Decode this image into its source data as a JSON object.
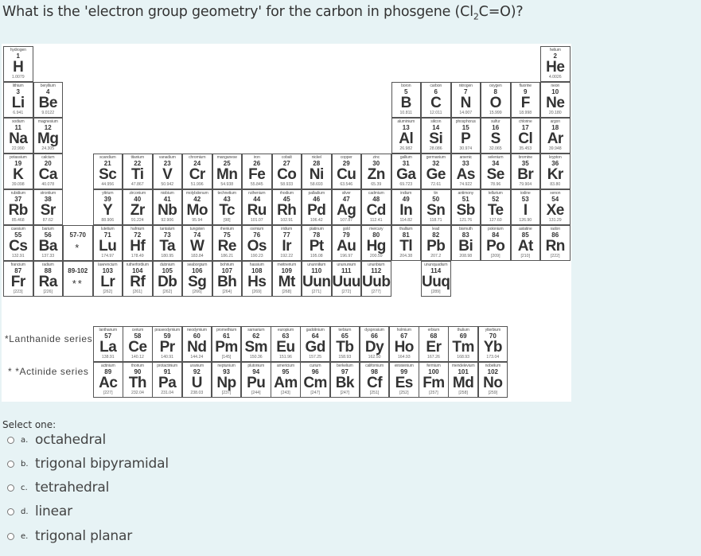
{
  "question": {
    "prefix": "What is the 'electron group geometry' for the carbon in phosgene (Cl",
    "subscript": "2",
    "suffix": "C=O)?"
  },
  "periodic_table": {
    "elements": [
      {
        "name": "hydrogen",
        "z": "1",
        "sym": "H",
        "mass": "1.0079",
        "row": 1,
        "col": 1
      },
      {
        "name": "helium",
        "z": "2",
        "sym": "He",
        "mass": "4.0026",
        "row": 1,
        "col": 19
      },
      {
        "name": "lithium",
        "z": "3",
        "sym": "Li",
        "mass": "6.941",
        "row": 2,
        "col": 1
      },
      {
        "name": "beryllium",
        "z": "4",
        "sym": "Be",
        "mass": "9.0122",
        "row": 2,
        "col": 2
      },
      {
        "name": "boron",
        "z": "5",
        "sym": "B",
        "mass": "10.811",
        "row": 2,
        "col": 14
      },
      {
        "name": "carbon",
        "z": "6",
        "sym": "C",
        "mass": "12.011",
        "row": 2,
        "col": 15
      },
      {
        "name": "nitrogen",
        "z": "7",
        "sym": "N",
        "mass": "14.007",
        "row": 2,
        "col": 16
      },
      {
        "name": "oxygen",
        "z": "8",
        "sym": "O",
        "mass": "15.999",
        "row": 2,
        "col": 17
      },
      {
        "name": "fluorine",
        "z": "9",
        "sym": "F",
        "mass": "18.998",
        "row": 2,
        "col": 18
      },
      {
        "name": "neon",
        "z": "10",
        "sym": "Ne",
        "mass": "20.180",
        "row": 2,
        "col": 19
      },
      {
        "name": "sodium",
        "z": "11",
        "sym": "Na",
        "mass": "22.990",
        "row": 3,
        "col": 1
      },
      {
        "name": "magnesium",
        "z": "12",
        "sym": "Mg",
        "mass": "24.305",
        "row": 3,
        "col": 2
      },
      {
        "name": "aluminium",
        "z": "13",
        "sym": "Al",
        "mass": "26.982",
        "row": 3,
        "col": 14
      },
      {
        "name": "silicon",
        "z": "14",
        "sym": "Si",
        "mass": "28.086",
        "row": 3,
        "col": 15
      },
      {
        "name": "phosphorus",
        "z": "15",
        "sym": "P",
        "mass": "30.974",
        "row": 3,
        "col": 16
      },
      {
        "name": "sulfur",
        "z": "16",
        "sym": "S",
        "mass": "32.065",
        "row": 3,
        "col": 17
      },
      {
        "name": "chlorine",
        "z": "17",
        "sym": "Cl",
        "mass": "35.453",
        "row": 3,
        "col": 18
      },
      {
        "name": "argon",
        "z": "18",
        "sym": "Ar",
        "mass": "39.948",
        "row": 3,
        "col": 19
      },
      {
        "name": "potassium",
        "z": "19",
        "sym": "K",
        "mass": "39.098",
        "row": 4,
        "col": 1
      },
      {
        "name": "calcium",
        "z": "20",
        "sym": "Ca",
        "mass": "40.078",
        "row": 4,
        "col": 2
      },
      {
        "name": "scandium",
        "z": "21",
        "sym": "Sc",
        "mass": "44.956",
        "row": 4,
        "col": 4
      },
      {
        "name": "titanium",
        "z": "22",
        "sym": "Ti",
        "mass": "47.867",
        "row": 4,
        "col": 5
      },
      {
        "name": "vanadium",
        "z": "23",
        "sym": "V",
        "mass": "50.942",
        "row": 4,
        "col": 6
      },
      {
        "name": "chromium",
        "z": "24",
        "sym": "Cr",
        "mass": "51.996",
        "row": 4,
        "col": 7
      },
      {
        "name": "manganese",
        "z": "25",
        "sym": "Mn",
        "mass": "54.938",
        "row": 4,
        "col": 8
      },
      {
        "name": "iron",
        "z": "26",
        "sym": "Fe",
        "mass": "55.845",
        "row": 4,
        "col": 9
      },
      {
        "name": "cobalt",
        "z": "27",
        "sym": "Co",
        "mass": "58.933",
        "row": 4,
        "col": 10
      },
      {
        "name": "nickel",
        "z": "28",
        "sym": "Ni",
        "mass": "58.693",
        "row": 4,
        "col": 11
      },
      {
        "name": "copper",
        "z": "29",
        "sym": "Cu",
        "mass": "63.546",
        "row": 4,
        "col": 12
      },
      {
        "name": "zinc",
        "z": "30",
        "sym": "Zn",
        "mass": "65.39",
        "row": 4,
        "col": 13
      },
      {
        "name": "gallium",
        "z": "31",
        "sym": "Ga",
        "mass": "69.723",
        "row": 4,
        "col": 14
      },
      {
        "name": "germanium",
        "z": "32",
        "sym": "Ge",
        "mass": "72.61",
        "row": 4,
        "col": 15
      },
      {
        "name": "arsenic",
        "z": "33",
        "sym": "As",
        "mass": "74.922",
        "row": 4,
        "col": 16
      },
      {
        "name": "selenium",
        "z": "34",
        "sym": "Se",
        "mass": "78.96",
        "row": 4,
        "col": 17
      },
      {
        "name": "bromine",
        "z": "35",
        "sym": "Br",
        "mass": "79.904",
        "row": 4,
        "col": 18
      },
      {
        "name": "krypton",
        "z": "36",
        "sym": "Kr",
        "mass": "83.80",
        "row": 4,
        "col": 19
      },
      {
        "name": "rubidium",
        "z": "37",
        "sym": "Rb",
        "mass": "85.468",
        "row": 5,
        "col": 1
      },
      {
        "name": "strontium",
        "z": "38",
        "sym": "Sr",
        "mass": "87.62",
        "row": 5,
        "col": 2
      },
      {
        "name": "yttrium",
        "z": "39",
        "sym": "Y",
        "mass": "88.906",
        "row": 5,
        "col": 4
      },
      {
        "name": "zirconium",
        "z": "40",
        "sym": "Zr",
        "mass": "91.224",
        "row": 5,
        "col": 5
      },
      {
        "name": "niobium",
        "z": "41",
        "sym": "Nb",
        "mass": "92.906",
        "row": 5,
        "col": 6
      },
      {
        "name": "molybdenum",
        "z": "42",
        "sym": "Mo",
        "mass": "95.94",
        "row": 5,
        "col": 7
      },
      {
        "name": "technetium",
        "z": "43",
        "sym": "Tc",
        "mass": "[98]",
        "row": 5,
        "col": 8
      },
      {
        "name": "ruthenium",
        "z": "44",
        "sym": "Ru",
        "mass": "101.07",
        "row": 5,
        "col": 9
      },
      {
        "name": "rhodium",
        "z": "45",
        "sym": "Rh",
        "mass": "102.91",
        "row": 5,
        "col": 10
      },
      {
        "name": "palladium",
        "z": "46",
        "sym": "Pd",
        "mass": "106.42",
        "row": 5,
        "col": 11
      },
      {
        "name": "silver",
        "z": "47",
        "sym": "Ag",
        "mass": "107.87",
        "row": 5,
        "col": 12
      },
      {
        "name": "cadmium",
        "z": "48",
        "sym": "Cd",
        "mass": "112.41",
        "row": 5,
        "col": 13
      },
      {
        "name": "indium",
        "z": "49",
        "sym": "In",
        "mass": "114.82",
        "row": 5,
        "col": 14
      },
      {
        "name": "tin",
        "z": "50",
        "sym": "Sn",
        "mass": "118.71",
        "row": 5,
        "col": 15
      },
      {
        "name": "antimony",
        "z": "51",
        "sym": "Sb",
        "mass": "121.76",
        "row": 5,
        "col": 16
      },
      {
        "name": "tellurium",
        "z": "52",
        "sym": "Te",
        "mass": "127.60",
        "row": 5,
        "col": 17
      },
      {
        "name": "iodine",
        "z": "53",
        "sym": "I",
        "mass": "126.90",
        "row": 5,
        "col": 18
      },
      {
        "name": "xenon",
        "z": "54",
        "sym": "Xe",
        "mass": "131.29",
        "row": 5,
        "col": 19
      },
      {
        "name": "caesium",
        "z": "55",
        "sym": "Cs",
        "mass": "132.91",
        "row": 6,
        "col": 1
      },
      {
        "name": "barium",
        "z": "56",
        "sym": "Ba",
        "mass": "137.33",
        "row": 6,
        "col": 2
      },
      {
        "name": "",
        "z": "57-70",
        "sym": "*",
        "mass": "",
        "row": 6,
        "col": 3,
        "placeholder": true
      },
      {
        "name": "lutetium",
        "z": "71",
        "sym": "Lu",
        "mass": "174.97",
        "row": 6,
        "col": 4
      },
      {
        "name": "hafnium",
        "z": "72",
        "sym": "Hf",
        "mass": "178.49",
        "row": 6,
        "col": 5
      },
      {
        "name": "tantalum",
        "z": "73",
        "sym": "Ta",
        "mass": "180.95",
        "row": 6,
        "col": 6
      },
      {
        "name": "tungsten",
        "z": "74",
        "sym": "W",
        "mass": "183.84",
        "row": 6,
        "col": 7
      },
      {
        "name": "rhenium",
        "z": "75",
        "sym": "Re",
        "mass": "186.21",
        "row": 6,
        "col": 8
      },
      {
        "name": "osmium",
        "z": "76",
        "sym": "Os",
        "mass": "190.23",
        "row": 6,
        "col": 9
      },
      {
        "name": "iridium",
        "z": "77",
        "sym": "Ir",
        "mass": "192.22",
        "row": 6,
        "col": 10
      },
      {
        "name": "platinum",
        "z": "78",
        "sym": "Pt",
        "mass": "195.08",
        "row": 6,
        "col": 11
      },
      {
        "name": "gold",
        "z": "79",
        "sym": "Au",
        "mass": "196.97",
        "row": 6,
        "col": 12
      },
      {
        "name": "mercury",
        "z": "80",
        "sym": "Hg",
        "mass": "200.59",
        "row": 6,
        "col": 13
      },
      {
        "name": "thallium",
        "z": "81",
        "sym": "Tl",
        "mass": "204.38",
        "row": 6,
        "col": 14
      },
      {
        "name": "lead",
        "z": "82",
        "sym": "Pb",
        "mass": "207.2",
        "row": 6,
        "col": 15
      },
      {
        "name": "bismuth",
        "z": "83",
        "sym": "Bi",
        "mass": "208.98",
        "row": 6,
        "col": 16
      },
      {
        "name": "polonium",
        "z": "84",
        "sym": "Po",
        "mass": "[209]",
        "row": 6,
        "col": 17
      },
      {
        "name": "astatine",
        "z": "85",
        "sym": "At",
        "mass": "[210]",
        "row": 6,
        "col": 18
      },
      {
        "name": "radon",
        "z": "86",
        "sym": "Rn",
        "mass": "[222]",
        "row": 6,
        "col": 19
      },
      {
        "name": "francium",
        "z": "87",
        "sym": "Fr",
        "mass": "[223]",
        "row": 7,
        "col": 1
      },
      {
        "name": "radium",
        "z": "88",
        "sym": "Ra",
        "mass": "[226]",
        "row": 7,
        "col": 2
      },
      {
        "name": "",
        "z": "89-102",
        "sym": "**",
        "mass": "",
        "row": 7,
        "col": 3,
        "placeholder": true
      },
      {
        "name": "lawrencium",
        "z": "103",
        "sym": "Lr",
        "mass": "[262]",
        "row": 7,
        "col": 4
      },
      {
        "name": "rutherfordium",
        "z": "104",
        "sym": "Rf",
        "mass": "[261]",
        "row": 7,
        "col": 5
      },
      {
        "name": "dubnium",
        "z": "105",
        "sym": "Db",
        "mass": "[262]",
        "row": 7,
        "col": 6
      },
      {
        "name": "seaborgium",
        "z": "106",
        "sym": "Sg",
        "mass": "[266]",
        "row": 7,
        "col": 7
      },
      {
        "name": "bohrium",
        "z": "107",
        "sym": "Bh",
        "mass": "[264]",
        "row": 7,
        "col": 8
      },
      {
        "name": "hassium",
        "z": "108",
        "sym": "Hs",
        "mass": "[269]",
        "row": 7,
        "col": 9
      },
      {
        "name": "meitnerium",
        "z": "109",
        "sym": "Mt",
        "mass": "[268]",
        "row": 7,
        "col": 10
      },
      {
        "name": "ununnilium",
        "z": "110",
        "sym": "Uun",
        "mass": "[271]",
        "row": 7,
        "col": 11
      },
      {
        "name": "unununium",
        "z": "111",
        "sym": "Uuu",
        "mass": "[272]",
        "row": 7,
        "col": 12
      },
      {
        "name": "ununbium",
        "z": "112",
        "sym": "Uub",
        "mass": "[277]",
        "row": 7,
        "col": 13
      },
      {
        "name": "ununquadium",
        "z": "114",
        "sym": "Uuq",
        "mass": "[289]",
        "row": 7,
        "col": 15
      }
    ],
    "lanthanide_label": "*Lanthanide series",
    "actinide_label": "* *Actinide series",
    "lanthanides": [
      {
        "name": "lanthanum",
        "z": "57",
        "sym": "La",
        "mass": "138.91"
      },
      {
        "name": "cerium",
        "z": "58",
        "sym": "Ce",
        "mass": "140.12"
      },
      {
        "name": "praseodymium",
        "z": "59",
        "sym": "Pr",
        "mass": "140.91"
      },
      {
        "name": "neodymium",
        "z": "60",
        "sym": "Nd",
        "mass": "144.24"
      },
      {
        "name": "promethium",
        "z": "61",
        "sym": "Pm",
        "mass": "[145]"
      },
      {
        "name": "samarium",
        "z": "62",
        "sym": "Sm",
        "mass": "150.36"
      },
      {
        "name": "europium",
        "z": "63",
        "sym": "Eu",
        "mass": "151.96"
      },
      {
        "name": "gadolinium",
        "z": "64",
        "sym": "Gd",
        "mass": "157.25"
      },
      {
        "name": "terbium",
        "z": "65",
        "sym": "Tb",
        "mass": "158.93"
      },
      {
        "name": "dysprosium",
        "z": "66",
        "sym": "Dy",
        "mass": "162.50"
      },
      {
        "name": "holmium",
        "z": "67",
        "sym": "Ho",
        "mass": "164.93"
      },
      {
        "name": "erbium",
        "z": "68",
        "sym": "Er",
        "mass": "167.26"
      },
      {
        "name": "thulium",
        "z": "69",
        "sym": "Tm",
        "mass": "168.93"
      },
      {
        "name": "ytterbium",
        "z": "70",
        "sym": "Yb",
        "mass": "173.04"
      }
    ],
    "actinides": [
      {
        "name": "actinium",
        "z": "89",
        "sym": "Ac",
        "mass": "[227]"
      },
      {
        "name": "thorium",
        "z": "90",
        "sym": "Th",
        "mass": "232.04"
      },
      {
        "name": "protactinium",
        "z": "91",
        "sym": "Pa",
        "mass": "231.04"
      },
      {
        "name": "uranium",
        "z": "92",
        "sym": "U",
        "mass": "238.03"
      },
      {
        "name": "neptunium",
        "z": "93",
        "sym": "Np",
        "mass": "[237]"
      },
      {
        "name": "plutonium",
        "z": "94",
        "sym": "Pu",
        "mass": "[244]"
      },
      {
        "name": "americium",
        "z": "95",
        "sym": "Am",
        "mass": "[243]"
      },
      {
        "name": "curium",
        "z": "96",
        "sym": "Cm",
        "mass": "[247]"
      },
      {
        "name": "berkelium",
        "z": "97",
        "sym": "Bk",
        "mass": "[247]"
      },
      {
        "name": "californium",
        "z": "98",
        "sym": "Cf",
        "mass": "[251]"
      },
      {
        "name": "einsteinium",
        "z": "99",
        "sym": "Es",
        "mass": "[252]"
      },
      {
        "name": "fermium",
        "z": "100",
        "sym": "Fm",
        "mass": "[257]"
      },
      {
        "name": "mendelevium",
        "z": "101",
        "sym": "Md",
        "mass": "[258]"
      },
      {
        "name": "nobelium",
        "z": "102",
        "sym": "No",
        "mass": "[259]"
      }
    ]
  },
  "answer": {
    "prompt": "Select one:",
    "options": [
      {
        "letter": "a.",
        "text": "octahedral",
        "selected": false
      },
      {
        "letter": "b.",
        "text": "trigonal bipyramidal",
        "selected": false
      },
      {
        "letter": "c.",
        "text": "tetrahedral",
        "selected": false
      },
      {
        "letter": "d.",
        "text": "linear",
        "selected": false
      },
      {
        "letter": "e.",
        "text": "trigonal planar",
        "selected": false
      }
    ]
  }
}
